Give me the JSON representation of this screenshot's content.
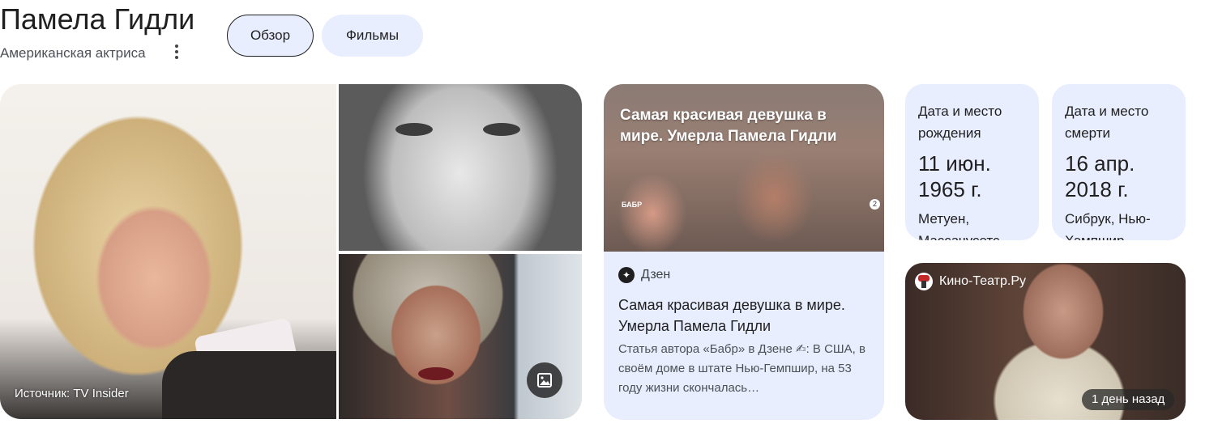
{
  "header": {
    "title": "Памела Гидли",
    "subtitle": "Американская актриса",
    "tabs": [
      {
        "label": "Обзор",
        "selected": true
      },
      {
        "label": "Фильмы",
        "selected": false
      }
    ]
  },
  "images": {
    "main_caption": "Источник: TV Insider",
    "gallery_icon": "image-gallery-icon"
  },
  "news": {
    "image_headline": "Самая красивая девушка в мире. Умерла Памела Гидли",
    "image_tag": "БАБР",
    "image_badge": "2",
    "source": "Дзен",
    "title": "Самая красивая девушка в мире. Умерла Памела Гидли",
    "snippet": "Статья автора «Бабр» в Дзене ✍: В США, в своём доме в штате Нью-Гемпшир, на 53 году жизни скончалась…"
  },
  "facts": {
    "birth": {
      "label": "Дата и место рождения",
      "value": "11 июн. 1965 г.",
      "place": "Метуен, Массачусетс"
    },
    "death": {
      "label": "Дата и место смерти",
      "value": "16 апр. 2018 г.",
      "place": "Сибрук, Нью-Хэмпшир"
    }
  },
  "video": {
    "source": "Кино-Театр.Ру",
    "time": "1 день назад"
  },
  "colors": {
    "card_bg": "#e8eefe",
    "text": "#1f1f1f"
  }
}
